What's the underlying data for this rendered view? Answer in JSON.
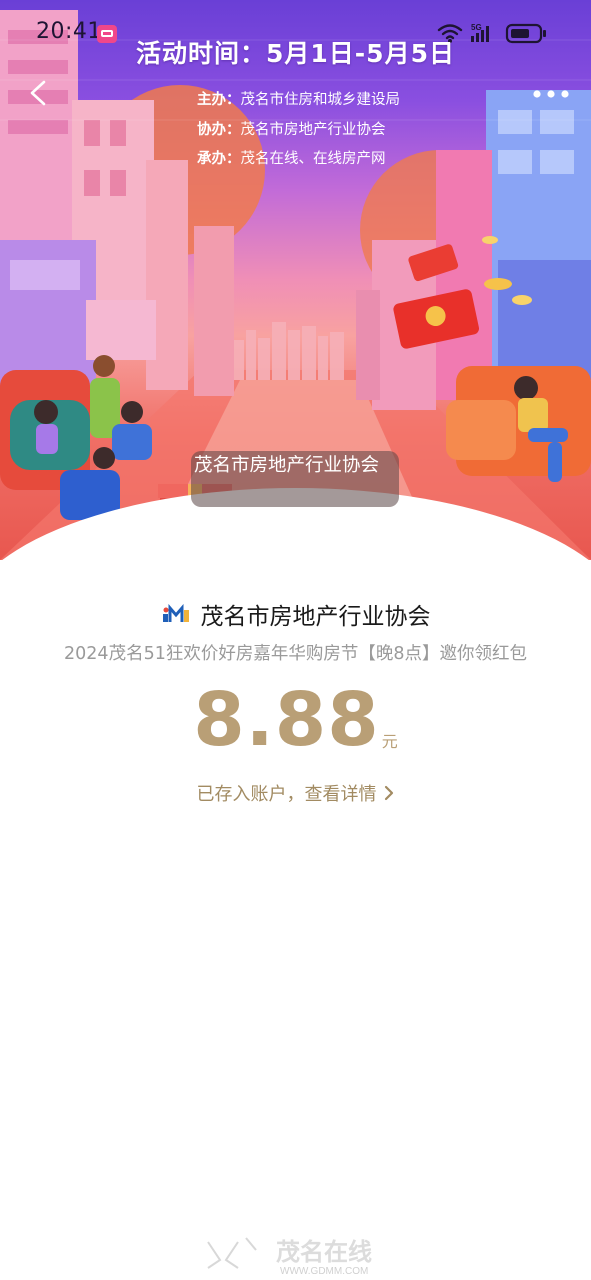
{
  "status_bar": {
    "time": "20:41",
    "network": "5G"
  },
  "banner": {
    "activity_time": "活动时间：5月1日-5月5日",
    "organizers": [
      {
        "role": "主办：",
        "name": "茂名市住房和城乡建设局"
      },
      {
        "role": "协办：",
        "name": "茂名市房地产行业协会"
      },
      {
        "role": "承办：",
        "name": "茂名在线、在线房产网"
      }
    ],
    "image_caption": "茂名市房地产行业协会"
  },
  "envelope": {
    "org_name": "茂名市房地产行业协会",
    "subtitle": "2024茂名51狂欢价好房嘉年华购房节【晚8点】邀你领红包",
    "amount": "8.88",
    "unit": "元",
    "detail_link": "已存入账户，查看详情"
  },
  "footer": {
    "watermark_text": "茂名在线",
    "watermark_url": "WWW.GDMM.COM"
  },
  "colors": {
    "gold": "#b99f76",
    "link_gold": "#a28b62",
    "banner_purple": "#6a3fd6",
    "banner_red": "#e8574f"
  }
}
